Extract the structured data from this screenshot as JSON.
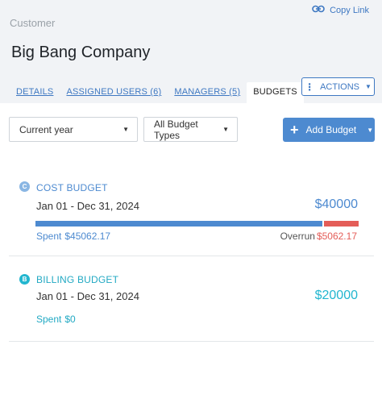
{
  "header": {
    "breadcrumb": "Customer",
    "copy_link": "Copy Link",
    "title": "Big Bang Company",
    "actions_label": "ACTIONS"
  },
  "tabs": [
    {
      "label": "DETAILS",
      "active": false
    },
    {
      "label": "ASSIGNED USERS (6)",
      "active": false
    },
    {
      "label": "MANAGERS (5)",
      "active": false
    },
    {
      "label": "BUDGETS",
      "active": true
    }
  ],
  "filters": {
    "period": "Current year",
    "budget_type": "All Budget Types"
  },
  "add_button": "Add Budget",
  "budgets": [
    {
      "badge": "C",
      "title": "COST BUDGET",
      "dates": "Jan 01 - Dec 31, 2024",
      "amount": "$40000",
      "spent_label": "Spent",
      "spent_value": "$45062.17",
      "overrun_label": "Overrun",
      "overrun_value": "$5062.17",
      "spent_fraction": 0.8877
    },
    {
      "badge": "B",
      "title": "BILLING BUDGET",
      "dates": "Jan 01 - Dec 31, 2024",
      "amount": "$20000",
      "spent_label": "Spent",
      "spent_value": "$0"
    }
  ],
  "colors": {
    "accent": "#4d8ad0",
    "billing": "#22b6cf",
    "overrun": "#e45d58"
  },
  "icons": {
    "copy": "link-icon",
    "actions": "vertical-dots-icon",
    "add": "plus-icon",
    "dropdown": "caret-down-icon"
  }
}
